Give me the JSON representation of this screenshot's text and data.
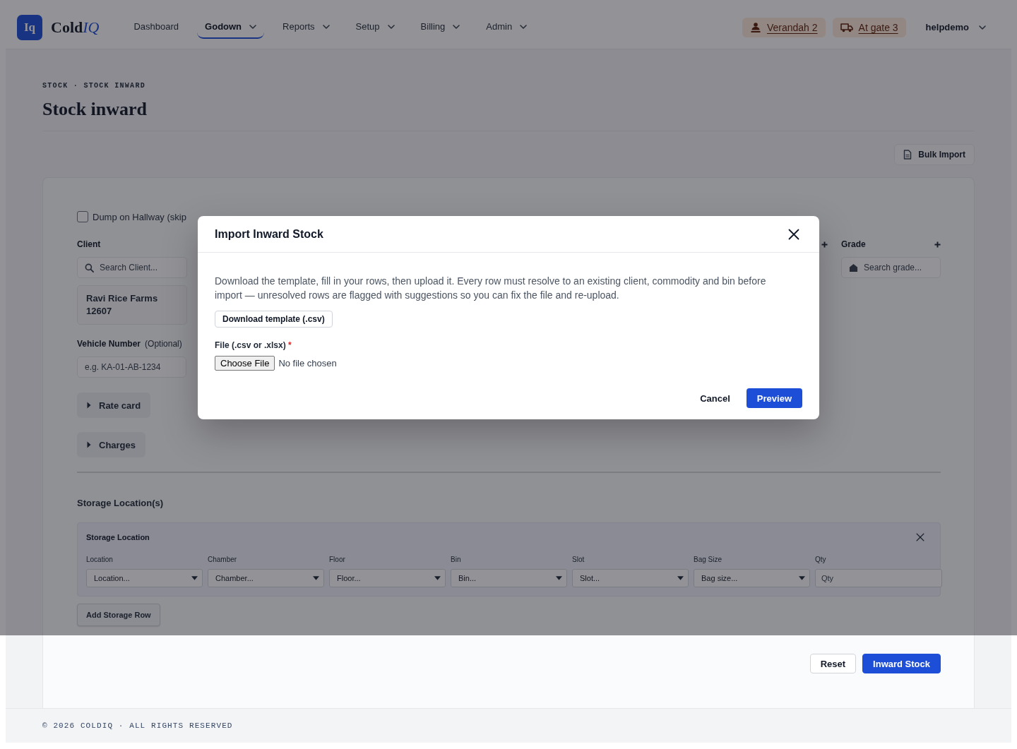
{
  "header": {
    "logo": {
      "mark": "Iq",
      "name": "Cold",
      "accent": "IQ"
    },
    "nav": [
      {
        "label": "Dashboard",
        "selected": false,
        "has_menu": false
      },
      {
        "label": "Godown",
        "selected": true,
        "has_menu": true
      },
      {
        "label": "Reports",
        "selected": false,
        "has_menu": true
      },
      {
        "label": "Setup",
        "selected": false,
        "has_menu": true
      },
      {
        "label": "Billing",
        "selected": false,
        "has_menu": true
      },
      {
        "label": "Admin",
        "selected": false,
        "has_menu": true
      }
    ],
    "badges": [
      {
        "kind": "verandah",
        "label": "Verandah 2"
      },
      {
        "kind": "gate",
        "label": "At gate 3"
      }
    ],
    "user": "helpdemo"
  },
  "breadcrumb": "STOCK · STOCK INWARD",
  "title": "Stock inward",
  "bulk_import": "Bulk Import",
  "form": {
    "halfway": {
      "label": "Dump on Hallway (skip",
      "checked": false
    },
    "client": {
      "label": "Client",
      "placeholder": "Search Client...",
      "selection": {
        "name": "Ravi Rice Farms",
        "code": "12607"
      }
    },
    "grade": {
      "label": "Grade",
      "placeholder": "Search grade..."
    },
    "vehicle": {
      "label": "Vehicle Number",
      "hint": "(Optional)",
      "placeholder": "e.g. KA-01-AB-1234"
    },
    "sections": [
      {
        "label": "Rate card",
        "expanded": false
      },
      {
        "label": "Charges",
        "expanded": false
      }
    ],
    "storage": {
      "heading": "Storage Location(s)",
      "rows": [
        {
          "title": "Storage Location",
          "fields": [
            {
              "kind": "select",
              "label": "Location",
              "placeholder": "Location..."
            },
            {
              "kind": "select",
              "label": "Chamber",
              "placeholder": "Chamber..."
            },
            {
              "kind": "select",
              "label": "Floor",
              "placeholder": "Floor..."
            },
            {
              "kind": "select",
              "label": "Bin",
              "placeholder": "Bin..."
            },
            {
              "kind": "select",
              "label": "Slot",
              "placeholder": "Slot..."
            },
            {
              "kind": "select",
              "label": "Bag Size",
              "placeholder": "Bag size..."
            },
            {
              "kind": "input",
              "label": "Qty",
              "placeholder": "Qty"
            }
          ]
        }
      ],
      "add_button": "Add Storage Row"
    },
    "actions": [
      {
        "kind": "secondary",
        "label": "Reset"
      },
      {
        "kind": "primary",
        "label": "Inward Stock"
      }
    ]
  },
  "footer": "© 2026 COLDIQ · ALL RIGHTS RESERVED",
  "modal": {
    "title": "Import Inward Stock",
    "description": "Download the template, fill in your rows, then upload it. Every row must resolve to an existing client, commodity and bin before import — unresolved rows are flagged with suggestions so you can fix the file and re-upload.",
    "template_button": "Download template (.csv)",
    "file_field": {
      "label": "File (.csv or .xlsx)",
      "required_mark": "*",
      "button": "Choose File",
      "status": "No file chosen"
    },
    "actions": [
      {
        "kind": "text",
        "label": "Cancel"
      },
      {
        "kind": "primary",
        "label": "Preview"
      }
    ]
  }
}
